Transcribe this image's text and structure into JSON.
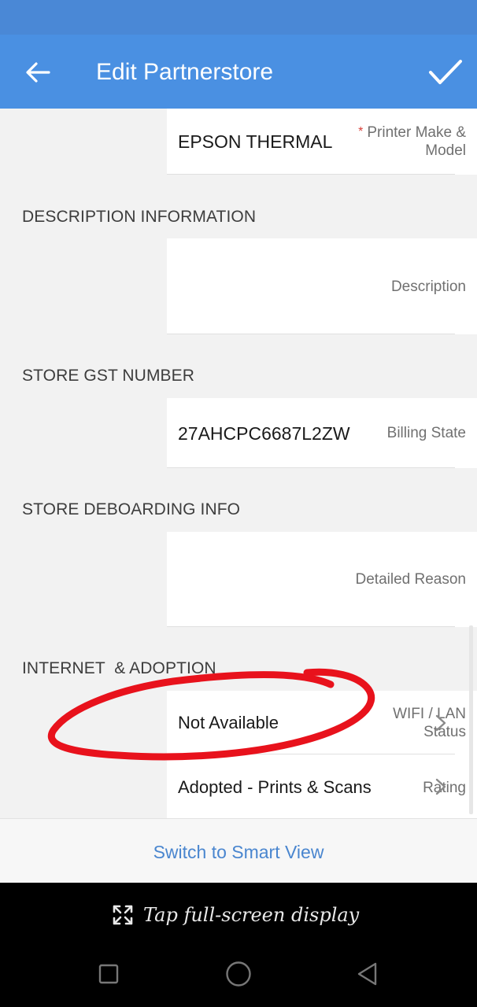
{
  "header": {
    "title": "Edit Partnerstore",
    "back_icon": "arrow-left-icon",
    "save_icon": "check-icon"
  },
  "fields": {
    "printer": {
      "required_mark": "*",
      "label_line1": "Printer Make &",
      "label_line2": "Model",
      "value": "EPSON THERMAL"
    },
    "description": {
      "label": "Description",
      "value": ""
    },
    "billing_state": {
      "label": "Billing State",
      "value": "27AHCPC6687L2ZW"
    },
    "detailed_reason": {
      "label": "Detailed Reason",
      "value": ""
    },
    "wifi_lan": {
      "label_line1": "WIFI / LAN",
      "label_line2": "Status",
      "value": "Not Available"
    },
    "rating": {
      "label": "Rating",
      "value": "Adopted - Prints & Scans"
    }
  },
  "sections": {
    "description_info": "DESCRIPTION INFORMATION",
    "store_gst": "STORE GST NUMBER",
    "store_deboarding": "STORE DEBOARDING INFO",
    "internet_adoption": "INTERNET  & ADOPTION"
  },
  "footer": {
    "smart_view_link": "Switch to Smart View"
  },
  "system": {
    "fullscreen_hint": "Tap full-screen display",
    "fullscreen_icon": "expand-arrows-icon",
    "nav_recents_icon": "square-icon",
    "nav_home_icon": "circle-icon",
    "nav_back_icon": "triangle-back-icon"
  },
  "colors": {
    "app_bar": "#4a90e2",
    "status_bar": "#4a88d6",
    "link": "#4a86cf",
    "required": "#d9413a",
    "annotation_circle": "#e8121c"
  }
}
